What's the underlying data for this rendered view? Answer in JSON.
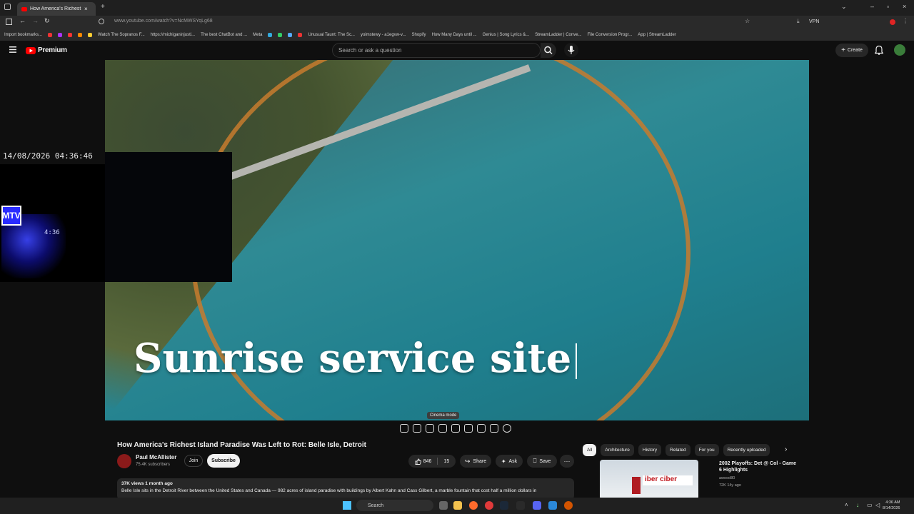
{
  "browser": {
    "tab_title": "How America's Richest Isla",
    "url": "www.youtube.com/watch?v=NcMWSYqLg68",
    "vpn_label": "VPN",
    "bookmarks": [
      "Import bookmarks...",
      "Watch The Sopranos F...",
      "https://michiganinjusti...",
      "The best ChatBot and ...",
      "Meta",
      "Unusual Taunt: The Sc...",
      "yoimstewy - a1egvw-v...",
      "Shopify",
      "How Many Days until ...",
      "Genius | Song Lyrics &...",
      "StreamLadder | Conve...",
      "File Conversion Progr...",
      "App | StreamLadder"
    ]
  },
  "youtube": {
    "logo": "Premium",
    "search_placeholder": "Search or ask a question",
    "create_label": "Create"
  },
  "video": {
    "overlay_text": "Sunrise service site",
    "tooltip": "Cinema mode"
  },
  "webcam": {
    "timestamp": "14/08/2026 04:36:46",
    "mtv": "MTV",
    "neon_clock": "4:36"
  },
  "meta": {
    "title": "How America's Richest Island Paradise Was Left to Rot: Belle Isle, Detroit",
    "channel": "Paul McAllister",
    "subscribers": "75.4K subscribers",
    "join_label": "Join",
    "subscribe_label": "Subscribe",
    "likes": "846",
    "dislikes": "15",
    "share_label": "Share",
    "ask_label": "Ask",
    "save_label": "Save",
    "views_age": "37K views  1 month ago",
    "description": "Belle Isle sits in the Detroit River between the United States and Canada — 982 acres of island paradise with buildings by Albert Kahn and Cass Gilbert, a marble fountain that cost half a million dollars in"
  },
  "chips": [
    "All",
    "Architecture",
    "History",
    "Related",
    "For you",
    "Recently uploaded"
  ],
  "recommendation": {
    "title": "2002 Playoffs: Det @ Col - Game 6 Highlights",
    "channel": "awood80",
    "meta": "72K  14y ago",
    "thumb_ad": "iber ciber"
  },
  "taskbar": {
    "search": "Search",
    "time": "4:36 AM",
    "date": "8/14/2026"
  }
}
